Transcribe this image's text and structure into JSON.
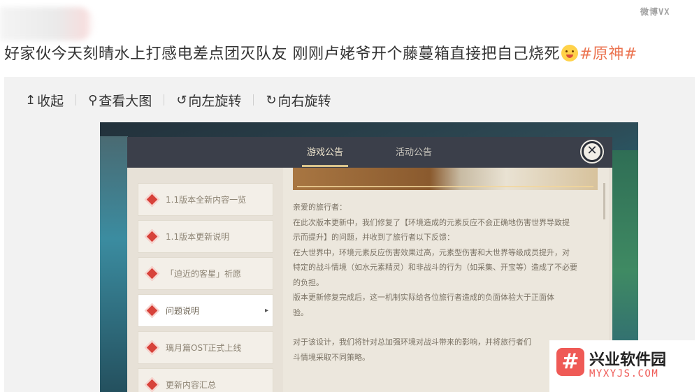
{
  "post": {
    "text": "好家伙今天刻晴水上打感电差点团灭队友 刚刚卢姥爷开个藤蔓箱直接把自己烧死",
    "hashtag": "#原神#"
  },
  "corner_logo": "微博VX",
  "toolbar": {
    "collapse": "收起",
    "view_large": "查看大图",
    "rotate_left": "向左旋转",
    "rotate_right": "向右旋转"
  },
  "game": {
    "tabs": [
      "游戏公告",
      "活动公告"
    ],
    "active_tab": "游戏公告",
    "close_symbol": "✕",
    "list_items": [
      "1.1版本全新内容一览",
      "1.1版本更新说明",
      "「迫近的客星」祈愿",
      "问题说明",
      "璃月篇OST正式上线",
      "更新内容汇总"
    ],
    "selected_item": "问题说明",
    "announcement": [
      "亲爱的旅行者：",
      "在此次版本更新中，我们修复了【环境造成的元素反应不会正确地伤害世界导致提",
      "示而提升】的问题，并收到了旅行者以下反馈：",
      "在大世界中，环境元素反应伤害效果过高，元素型伤害和大世界等级成员提升，对",
      "特定的战斗情境（如水元素精灵）和非战斗的行为（如采集、开宝等）造成了不必要",
      "的负担。",
      "版本更新修复完成后，这一机制实际给各位旅行者造成的负面体验大于正面体",
      "验。",
      "",
      "对于该设计，我们将针对总加强环境对战斗带来的影响，并将旅行者们",
      "斗情境采取不同策略。"
    ]
  },
  "watermark": {
    "logo_char": "#",
    "title": "兴业软件园",
    "url": "MYXYJS.COM"
  },
  "colors": {
    "hashtag": "#eb7350",
    "panel_header": "#3b3f4a",
    "panel_body": "#e7e1d7",
    "alert_diamond": "#d7423a",
    "watermark_red": "#ef5a56"
  }
}
